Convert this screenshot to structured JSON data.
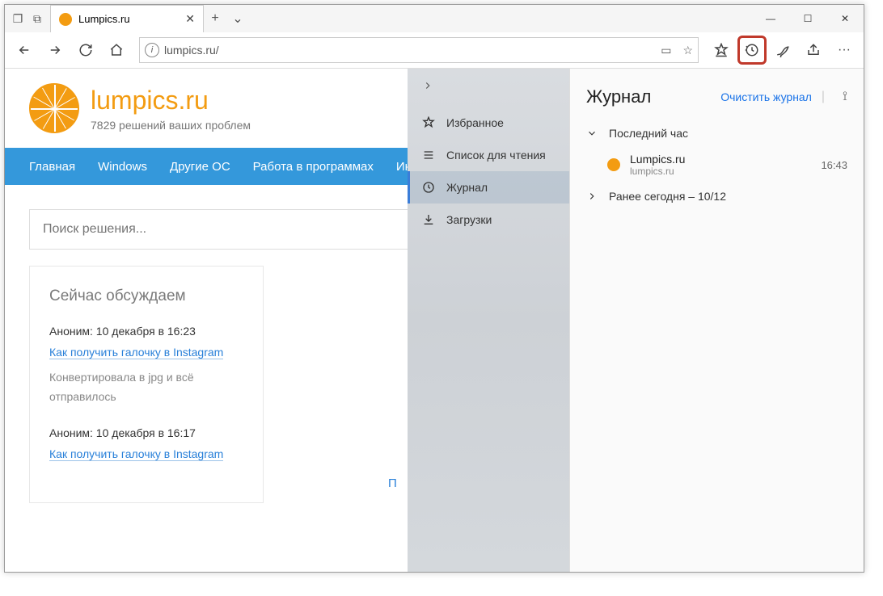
{
  "tab": {
    "title": "Lumpics.ru"
  },
  "url": "lumpics.ru/",
  "site": {
    "name": "lumpics.ru",
    "tagline": "7829 решений ваших проблем",
    "nav": [
      "Главная",
      "Windows",
      "Другие ОС",
      "Работа в программах",
      "Ин"
    ],
    "search_placeholder": "Поиск решения...",
    "discuss_heading": "Сейчас обсуждаем",
    "discuss": [
      {
        "author": "Аноним: 10 декабря в 16:23",
        "link": "Как получить галочку в Instagram",
        "body": "Конвертировала в jpg и всё отправилось"
      },
      {
        "author": "Аноним: 10 декабря в 16:17",
        "link": "Как получить галочку в Instagram",
        "body": ""
      }
    ],
    "partial": "П"
  },
  "hub": {
    "items": [
      {
        "icon": "star",
        "label": "Избранное"
      },
      {
        "icon": "list",
        "label": "Список для чтения"
      },
      {
        "icon": "history",
        "label": "Журнал"
      },
      {
        "icon": "download",
        "label": "Загрузки"
      }
    ],
    "title": "Журнал",
    "clear": "Очистить журнал",
    "sections": [
      {
        "expanded": true,
        "label": "Последний час",
        "entries": [
          {
            "title": "Lumpics.ru",
            "domain": "lumpics.ru",
            "time": "16:43"
          }
        ]
      },
      {
        "expanded": false,
        "label": "Ранее сегодня – 10/12",
        "entries": []
      }
    ]
  }
}
